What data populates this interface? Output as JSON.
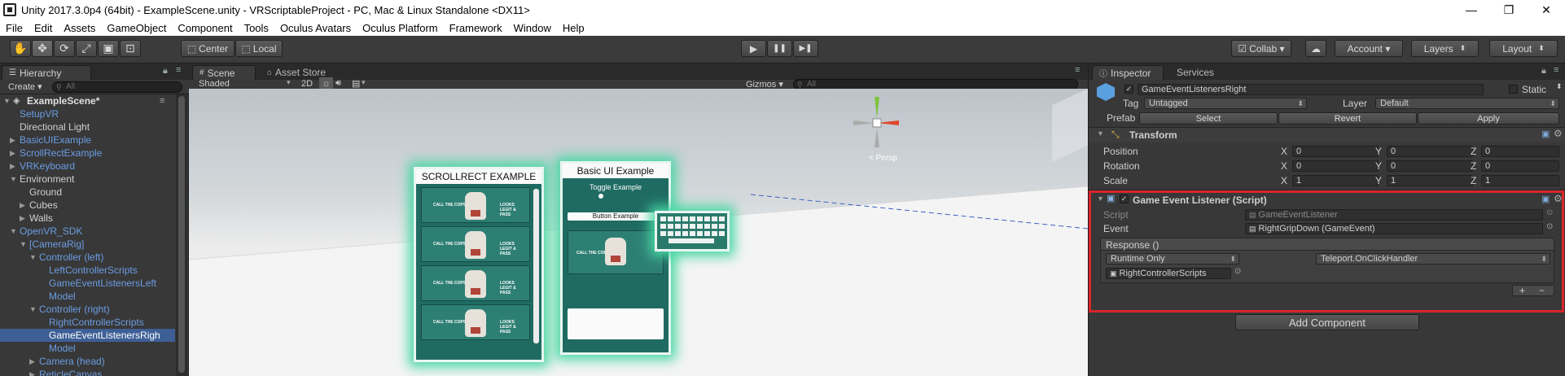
{
  "window": {
    "title": "Unity 2017.3.0p4 (64bit) - ExampleScene.unity - VRScriptableProject - PC, Mac & Linux Standalone <DX11>",
    "minimize": "—",
    "maximize": "❐",
    "close": "✕"
  },
  "menu": [
    "File",
    "Edit",
    "Assets",
    "GameObject",
    "Component",
    "Tools",
    "Oculus Avatars",
    "Oculus Platform",
    "Framework",
    "Window",
    "Help"
  ],
  "toolbar": {
    "tools": [
      "hand-icon",
      "move-icon",
      "rotate-icon",
      "scale-icon",
      "rect-icon",
      "transform-icon"
    ],
    "pivot": "Center",
    "space": "Local",
    "play": "▶",
    "pause": "❚❚",
    "step": "▶❚",
    "collab": "Collab ▾",
    "account": "Account ▾",
    "layers": "Layers",
    "layout": "Layout"
  },
  "hierarchy": {
    "tab": "Hierarchy",
    "create": "Create ▾",
    "search_placeholder": "All",
    "scene_name": "ExampleScene*",
    "rows": [
      {
        "label": "SetupVR",
        "depth": 1,
        "color": "blue",
        "arrow": ""
      },
      {
        "label": "Directional Light",
        "depth": 1,
        "color": "grey",
        "arrow": ""
      },
      {
        "label": "BasicUIExample",
        "depth": 1,
        "color": "blue",
        "arrow": "▶"
      },
      {
        "label": "ScrollRectExample",
        "depth": 1,
        "color": "blue",
        "arrow": "▶"
      },
      {
        "label": "VRKeyboard",
        "depth": 1,
        "color": "blue",
        "arrow": "▶"
      },
      {
        "label": "Environment",
        "depth": 1,
        "color": "grey",
        "arrow": "▼"
      },
      {
        "label": "Ground",
        "depth": 2,
        "color": "grey",
        "arrow": ""
      },
      {
        "label": "Cubes",
        "depth": 2,
        "color": "grey",
        "arrow": "▶"
      },
      {
        "label": "Walls",
        "depth": 2,
        "color": "grey",
        "arrow": "▶"
      },
      {
        "label": "OpenVR_SDK",
        "depth": 1,
        "color": "blue",
        "arrow": "▼"
      },
      {
        "label": "[CameraRig]",
        "depth": 2,
        "color": "blue",
        "arrow": "▼"
      },
      {
        "label": "Controller (left)",
        "depth": 3,
        "color": "blue",
        "arrow": "▼"
      },
      {
        "label": "LeftControllerScripts",
        "depth": 4,
        "color": "blue",
        "arrow": ""
      },
      {
        "label": "GameEventListenersLeft",
        "depth": 4,
        "color": "blue",
        "arrow": ""
      },
      {
        "label": "Model",
        "depth": 4,
        "color": "blue",
        "arrow": ""
      },
      {
        "label": "Controller (right)",
        "depth": 3,
        "color": "blue",
        "arrow": "▼"
      },
      {
        "label": "RightControllerScripts",
        "depth": 4,
        "color": "blue",
        "arrow": ""
      },
      {
        "label": "GameEventListenersRigh",
        "depth": 4,
        "color": "grey",
        "arrow": "",
        "selected": true
      },
      {
        "label": "Model",
        "depth": 4,
        "color": "blue",
        "arrow": ""
      },
      {
        "label": "Camera (head)",
        "depth": 3,
        "color": "blue",
        "arrow": "▶"
      },
      {
        "label": "ReticleCanvas",
        "depth": 3,
        "color": "blue",
        "arrow": "▶"
      }
    ]
  },
  "scene": {
    "tabs": [
      "Scene",
      "Asset Store"
    ],
    "shading": "Shaded",
    "mode_2d": "2D",
    "gizmos": "Gizmos ▾",
    "search_placeholder": "All",
    "persp_label": "< Persp",
    "scroll_panel_title": "SCROLLRECT EXAMPLE",
    "basic_panel_title": "Basic UI Example",
    "toggle_label": "Toggle Example",
    "button_label": "Button Example",
    "call_the_cops": "CALL THE COPS",
    "looks_legit": "LOOKS LEGIT & PASS"
  },
  "inspector": {
    "tabs": [
      "Inspector",
      "Services"
    ],
    "object_name": "GameEventListenersRight",
    "static_label": "Static",
    "tag_label": "Tag",
    "tag_value": "Untagged",
    "layer_label": "Layer",
    "layer_value": "Default",
    "prefab_label": "Prefab",
    "prefab_buttons": [
      "Select",
      "Revert",
      "Apply"
    ],
    "transform_title": "Transform",
    "transform": {
      "position": {
        "label": "Position",
        "x": "0",
        "y": "0",
        "z": "0"
      },
      "rotation": {
        "label": "Rotation",
        "x": "0",
        "y": "0",
        "z": "0"
      },
      "scale": {
        "label": "Scale",
        "x": "1",
        "y": "1",
        "z": "1"
      }
    },
    "axis_labels": [
      "X",
      "Y",
      "Z"
    ],
    "script_component_title": "Game Event Listener (Script)",
    "script_label": "Script",
    "script_value": "GameEventListener",
    "event_label": "Event",
    "event_value": "RightGripDown (GameEvent)",
    "response_label": "Response ()",
    "runtime_value": "Runtime Only",
    "handler_value": "Teleport.OnClickHandler",
    "target_value": "RightControllerScripts",
    "plus": "+",
    "minus": "−",
    "add_component": "Add Component",
    "highlight_color": "#d8262b"
  }
}
